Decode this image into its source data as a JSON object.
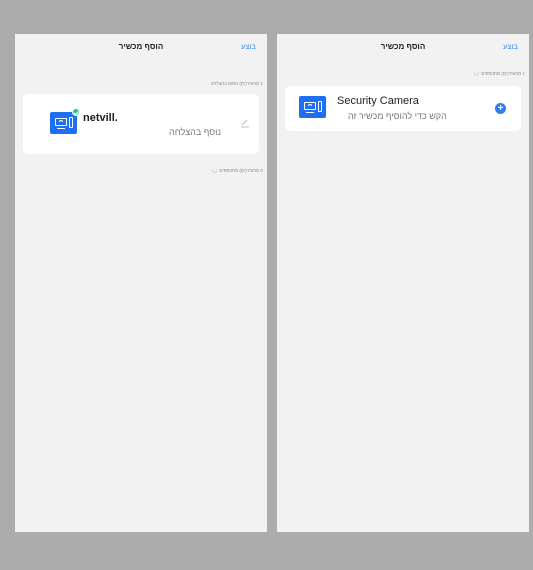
{
  "left_screen": {
    "nav": {
      "done_label": "בוצע",
      "title": "הוסף מכשיר"
    },
    "success_section_label": "1 מכשיר(ים) נוספו בהצלחה",
    "added_device": {
      "name": "netvill.",
      "status": "נוסף בהצלחה",
      "icon": "camera-device-icon",
      "badge_icon": "check-badge-icon",
      "edit_icon": "pencil-icon"
    },
    "pending_section_label": "0 מכשיר(ים) מתווספים"
  },
  "right_screen": {
    "nav": {
      "done_label": "בוצע",
      "title": "הוסף מכשיר"
    },
    "pending_section_label": "1 מכשיר(ים) מתווספים",
    "discovered_device": {
      "name": "Security Camera",
      "hint": "הקש כדי להוסיף מכשיר זה",
      "icon": "camera-device-icon",
      "add_icon": "plus-circle-icon"
    }
  },
  "colors": {
    "background": "#acacac",
    "screen": "#f2f2f2",
    "card": "#ffffff",
    "accent": "#3d8bf2",
    "device_icon": "#1f6ff2",
    "success": "#2bc17a"
  }
}
